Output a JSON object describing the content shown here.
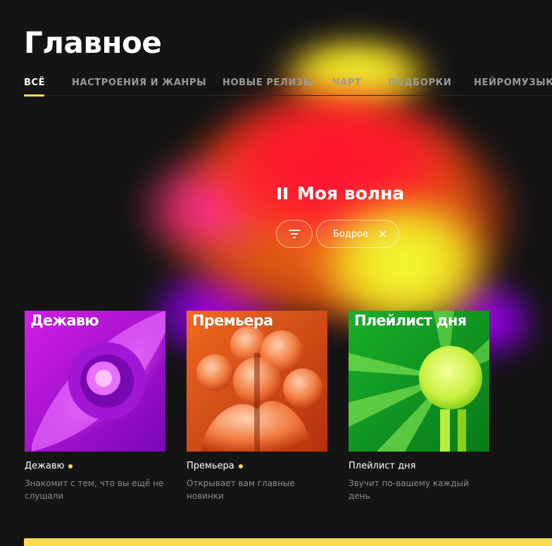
{
  "page": {
    "title": "Главное",
    "accent_color": "#ffdb4d"
  },
  "tabs": [
    {
      "label": "ВСЁ",
      "active": true
    },
    {
      "label": "НАСТРОЕНИЯ И ЖАНРЫ",
      "active": false
    },
    {
      "label": "НОВЫЕ РЕЛИЗЫ",
      "active": false
    },
    {
      "label": "ЧАРТ",
      "active": false
    },
    {
      "label": "ПОДБОРКИ",
      "active": false
    },
    {
      "label": "НЕЙРОМУЗЫКА",
      "active": false
    }
  ],
  "wave": {
    "title": "Моя волна",
    "state_icon": "pause-icon",
    "filter_icon": "filter-icon",
    "chip_label": "Бодрое",
    "chip_close_icon": "close-icon"
  },
  "playlists": [
    {
      "cover_text": "Дежавю",
      "name": "Дежавю",
      "has_dot": true,
      "description": "Знакомит с тем, что вы ещё не слушали",
      "color": "#c21bd6"
    },
    {
      "cover_text": "Премьера",
      "name": "Премьера",
      "has_dot": true,
      "description": "Открывает вам главные новинки",
      "color": "#e2541c"
    },
    {
      "cover_text": "Плейлист дня",
      "name": "Плейлист дня",
      "has_dot": false,
      "description": "Звучит по-вашему каждый день",
      "color": "#1aa82a"
    }
  ]
}
